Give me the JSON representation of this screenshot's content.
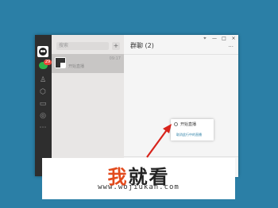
{
  "sidebar": {
    "badge": "29",
    "icons": [
      "avatar-icon",
      "chat-icon",
      "contacts-icon",
      "favorites-icon",
      "folder-icon",
      "moments-icon",
      "more-icon"
    ]
  },
  "list": {
    "search_placeholder": "搜索",
    "add_label": "+",
    "conversation": {
      "time": "09:17",
      "message": "开始直播"
    }
  },
  "chat": {
    "title": "群聊 (2)",
    "minimize": "—",
    "maximize": "□",
    "close": "×",
    "more": "···"
  },
  "popup": {
    "item_start_live": "开始直播",
    "item_sub": "取消此行中的直播"
  },
  "watermark": {
    "brand_part1": "我",
    "brand_part2": "就看",
    "url": "www.wojiukan.com"
  },
  "colors": {
    "background": "#2b7fa6",
    "sidebar": "#2e2e2e",
    "accent_green": "#2bb34a",
    "badge_red": "#e9463a",
    "brand_orange": "#e24a1c"
  }
}
